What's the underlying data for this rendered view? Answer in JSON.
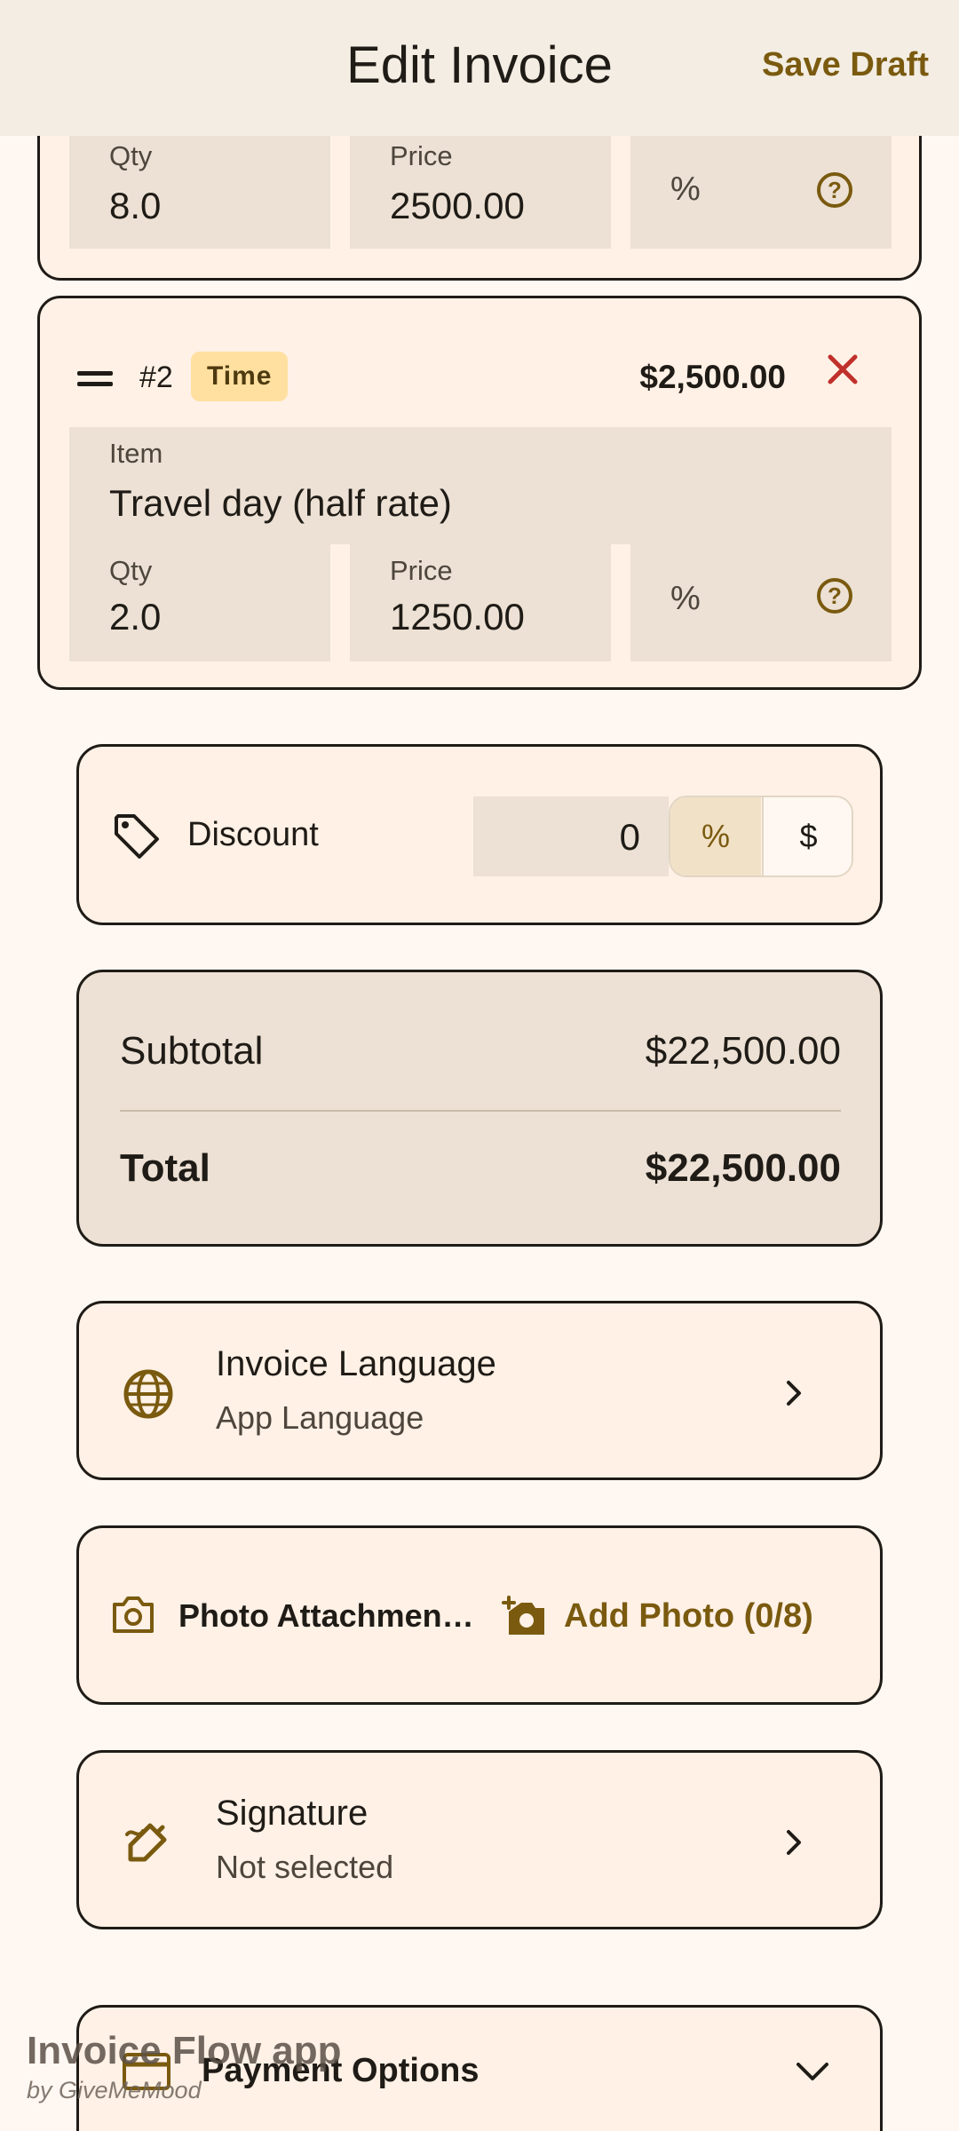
{
  "header": {
    "title": "Edit Invoice",
    "save_draft": "Save Draft"
  },
  "item1": {
    "qty_label": "Qty",
    "qty_value": "8.0",
    "price_label": "Price",
    "price_value": "2500.00",
    "discount_unit": "%"
  },
  "item2": {
    "number": "#2",
    "badge": "Time",
    "amount": "$2,500.00",
    "item_label": "Item",
    "item_value": "Travel day (half rate)",
    "qty_label": "Qty",
    "qty_value": "2.0",
    "price_label": "Price",
    "price_value": "1250.00",
    "discount_unit": "%"
  },
  "discount": {
    "label": "Discount",
    "value": "0",
    "toggle_percent": "%",
    "toggle_dollar": "$"
  },
  "totals": {
    "subtotal_label": "Subtotal",
    "subtotal_value": "$22,500.00",
    "total_label": "Total",
    "total_value": "$22,500.00"
  },
  "language": {
    "title": "Invoice Language",
    "subtitle": "App Language"
  },
  "photos": {
    "title": "Photo Attachmen…",
    "add_label": "Add Photo (0/8)"
  },
  "signature": {
    "title": "Signature",
    "subtitle": "Not selected"
  },
  "payment": {
    "title": "Payment Options"
  },
  "watermark": {
    "line1": "Invoice Flow app",
    "line2": "by GiveMeMood"
  },
  "colors": {
    "accent": "#7A5A0F",
    "background": "#FFF8F2",
    "card": "#FFF1E6",
    "field": "#ECE1D4",
    "delete": "#C0302B",
    "badge": "#FFE0A0"
  }
}
